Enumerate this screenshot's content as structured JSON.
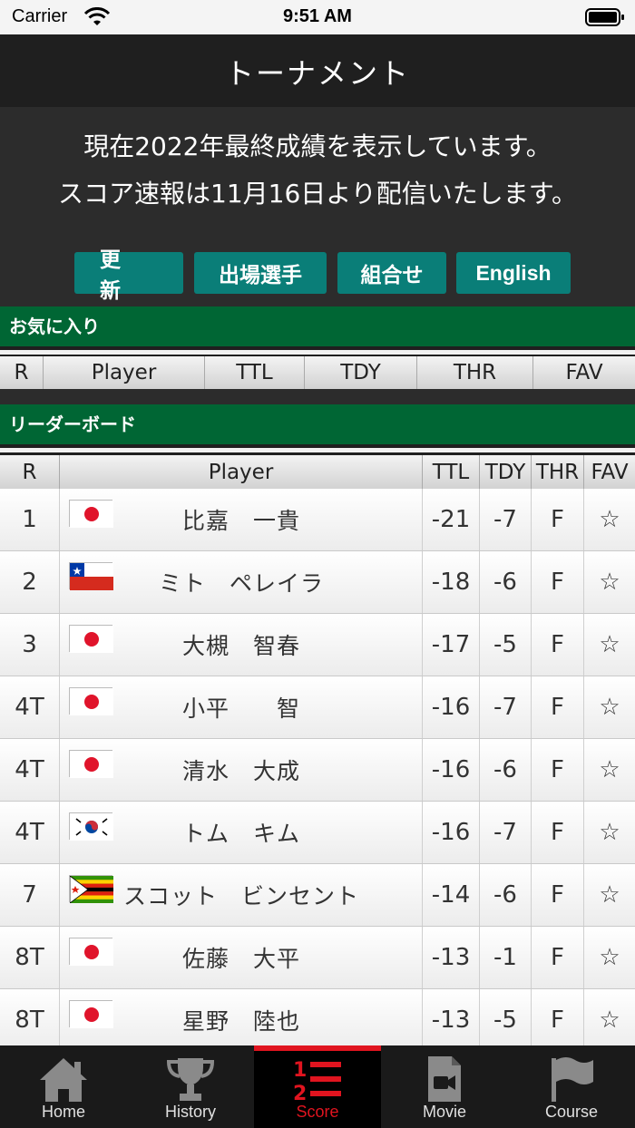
{
  "status_bar": {
    "carrier": "Carrier",
    "time": "9:51 AM"
  },
  "nav": {
    "title": "トーナメント"
  },
  "notice": {
    "line1": "現在2022年最終成績を表示しています。",
    "line2": "スコア速報は11月16日より配信いたします。"
  },
  "buttons": {
    "refresh": "更新",
    "entry": "出場選手",
    "pairing": "組合せ",
    "english": "English"
  },
  "favorites": {
    "title": "お気に入り",
    "columns": [
      "R",
      "Player",
      "TTL",
      "TDY",
      "THR",
      "FAV"
    ]
  },
  "leaderboard": {
    "title": "リーダーボード",
    "columns": [
      "R",
      "Player",
      "TTL",
      "TDY",
      "THR",
      "FAV"
    ],
    "rows": [
      {
        "rank": "1",
        "flag": "japan",
        "player": "比嘉　一貴",
        "ttl": "-21",
        "tdy": "-7",
        "thr": "F",
        "fav": "☆"
      },
      {
        "rank": "2",
        "flag": "chile",
        "player": "ミト　ペレイラ",
        "ttl": "-18",
        "tdy": "-6",
        "thr": "F",
        "fav": "☆"
      },
      {
        "rank": "3",
        "flag": "japan",
        "player": "大槻　智春",
        "ttl": "-17",
        "tdy": "-5",
        "thr": "F",
        "fav": "☆"
      },
      {
        "rank": "4T",
        "flag": "japan",
        "player": "小平　　智",
        "ttl": "-16",
        "tdy": "-7",
        "thr": "F",
        "fav": "☆"
      },
      {
        "rank": "4T",
        "flag": "japan",
        "player": "清水　大成",
        "ttl": "-16",
        "tdy": "-6",
        "thr": "F",
        "fav": "☆"
      },
      {
        "rank": "4T",
        "flag": "korea",
        "player": "トム　キム",
        "ttl": "-16",
        "tdy": "-7",
        "thr": "F",
        "fav": "☆"
      },
      {
        "rank": "7",
        "flag": "zimbabwe",
        "player": "スコット　ビンセント",
        "ttl": "-14",
        "tdy": "-6",
        "thr": "F",
        "fav": "☆"
      },
      {
        "rank": "8T",
        "flag": "japan",
        "player": "佐藤　大平",
        "ttl": "-13",
        "tdy": "-1",
        "thr": "F",
        "fav": "☆"
      },
      {
        "rank": "8T",
        "flag": "japan",
        "player": "星野　陸也",
        "ttl": "-13",
        "tdy": "-5",
        "thr": "F",
        "fav": "☆"
      }
    ]
  },
  "tabs": [
    {
      "label": "Home",
      "icon": "home-icon"
    },
    {
      "label": "History",
      "icon": "trophy-icon"
    },
    {
      "label": "Score",
      "icon": "score-list-icon",
      "active": true
    },
    {
      "label": "Movie",
      "icon": "movie-file-icon"
    },
    {
      "label": "Course",
      "icon": "flag-icon"
    }
  ],
  "colors": {
    "accent_green": "#006634",
    "button_teal": "#0a7e78",
    "active_red": "#e0141f"
  }
}
